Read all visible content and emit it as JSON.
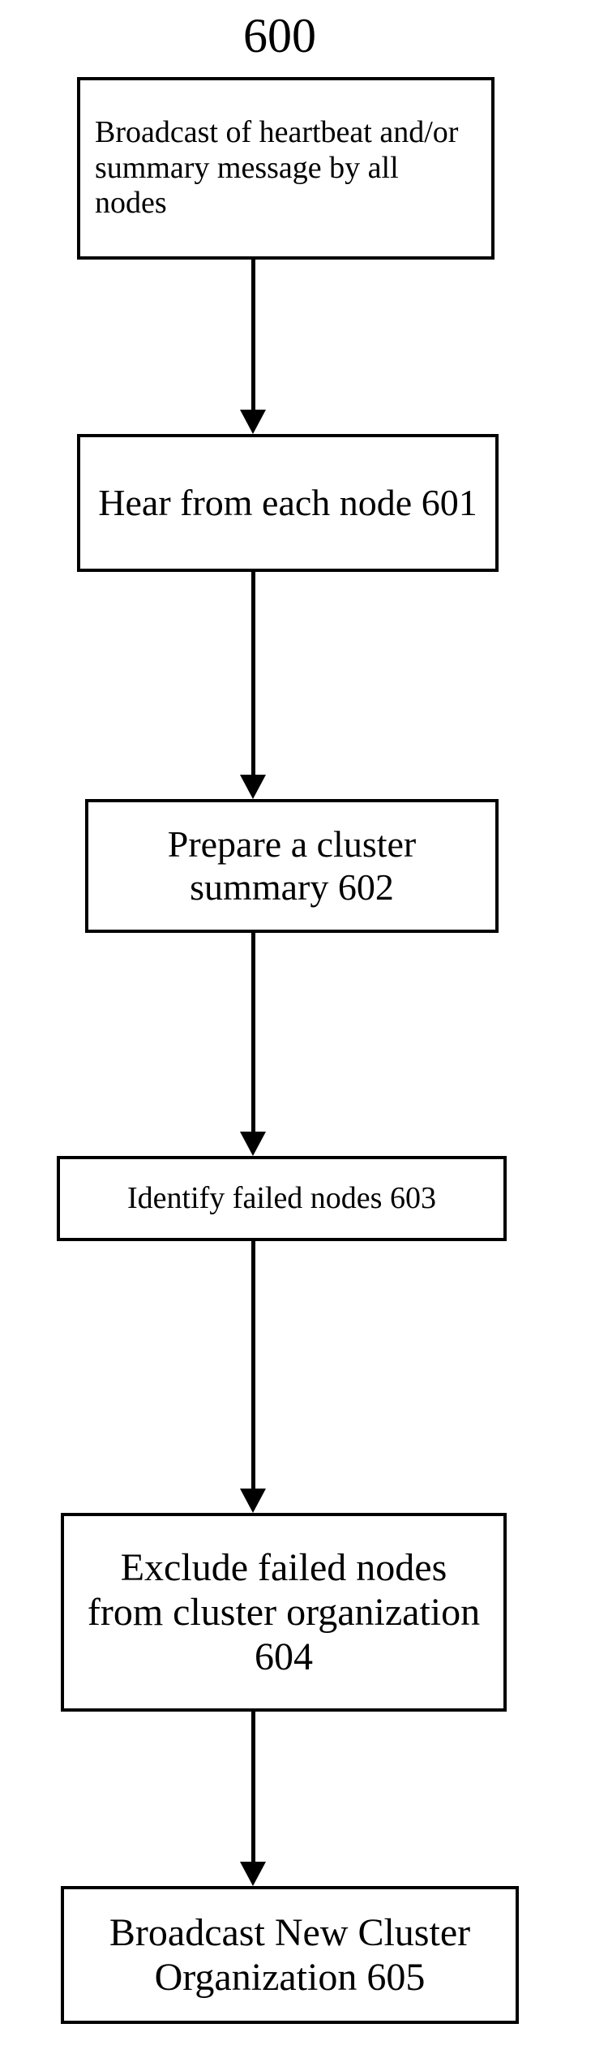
{
  "chart_data": {
    "type": "flowchart",
    "title": "600",
    "nodes": [
      {
        "id": "n0",
        "label": "Broadcast of heartbeat and/or summary message by all nodes"
      },
      {
        "id": "n1",
        "label": "Hear from each node 601"
      },
      {
        "id": "n2",
        "label": "Prepare a cluster summary 602"
      },
      {
        "id": "n3",
        "label": "Identify failed nodes 603"
      },
      {
        "id": "n4",
        "label": "Exclude failed nodes from cluster organization 604"
      },
      {
        "id": "n5",
        "label": "Broadcast New Cluster Organization 605"
      }
    ],
    "edges": [
      {
        "from": "n0",
        "to": "n1"
      },
      {
        "from": "n1",
        "to": "n2"
      },
      {
        "from": "n2",
        "to": "n3"
      },
      {
        "from": "n3",
        "to": "n4"
      },
      {
        "from": "n4",
        "to": "n5"
      }
    ]
  }
}
